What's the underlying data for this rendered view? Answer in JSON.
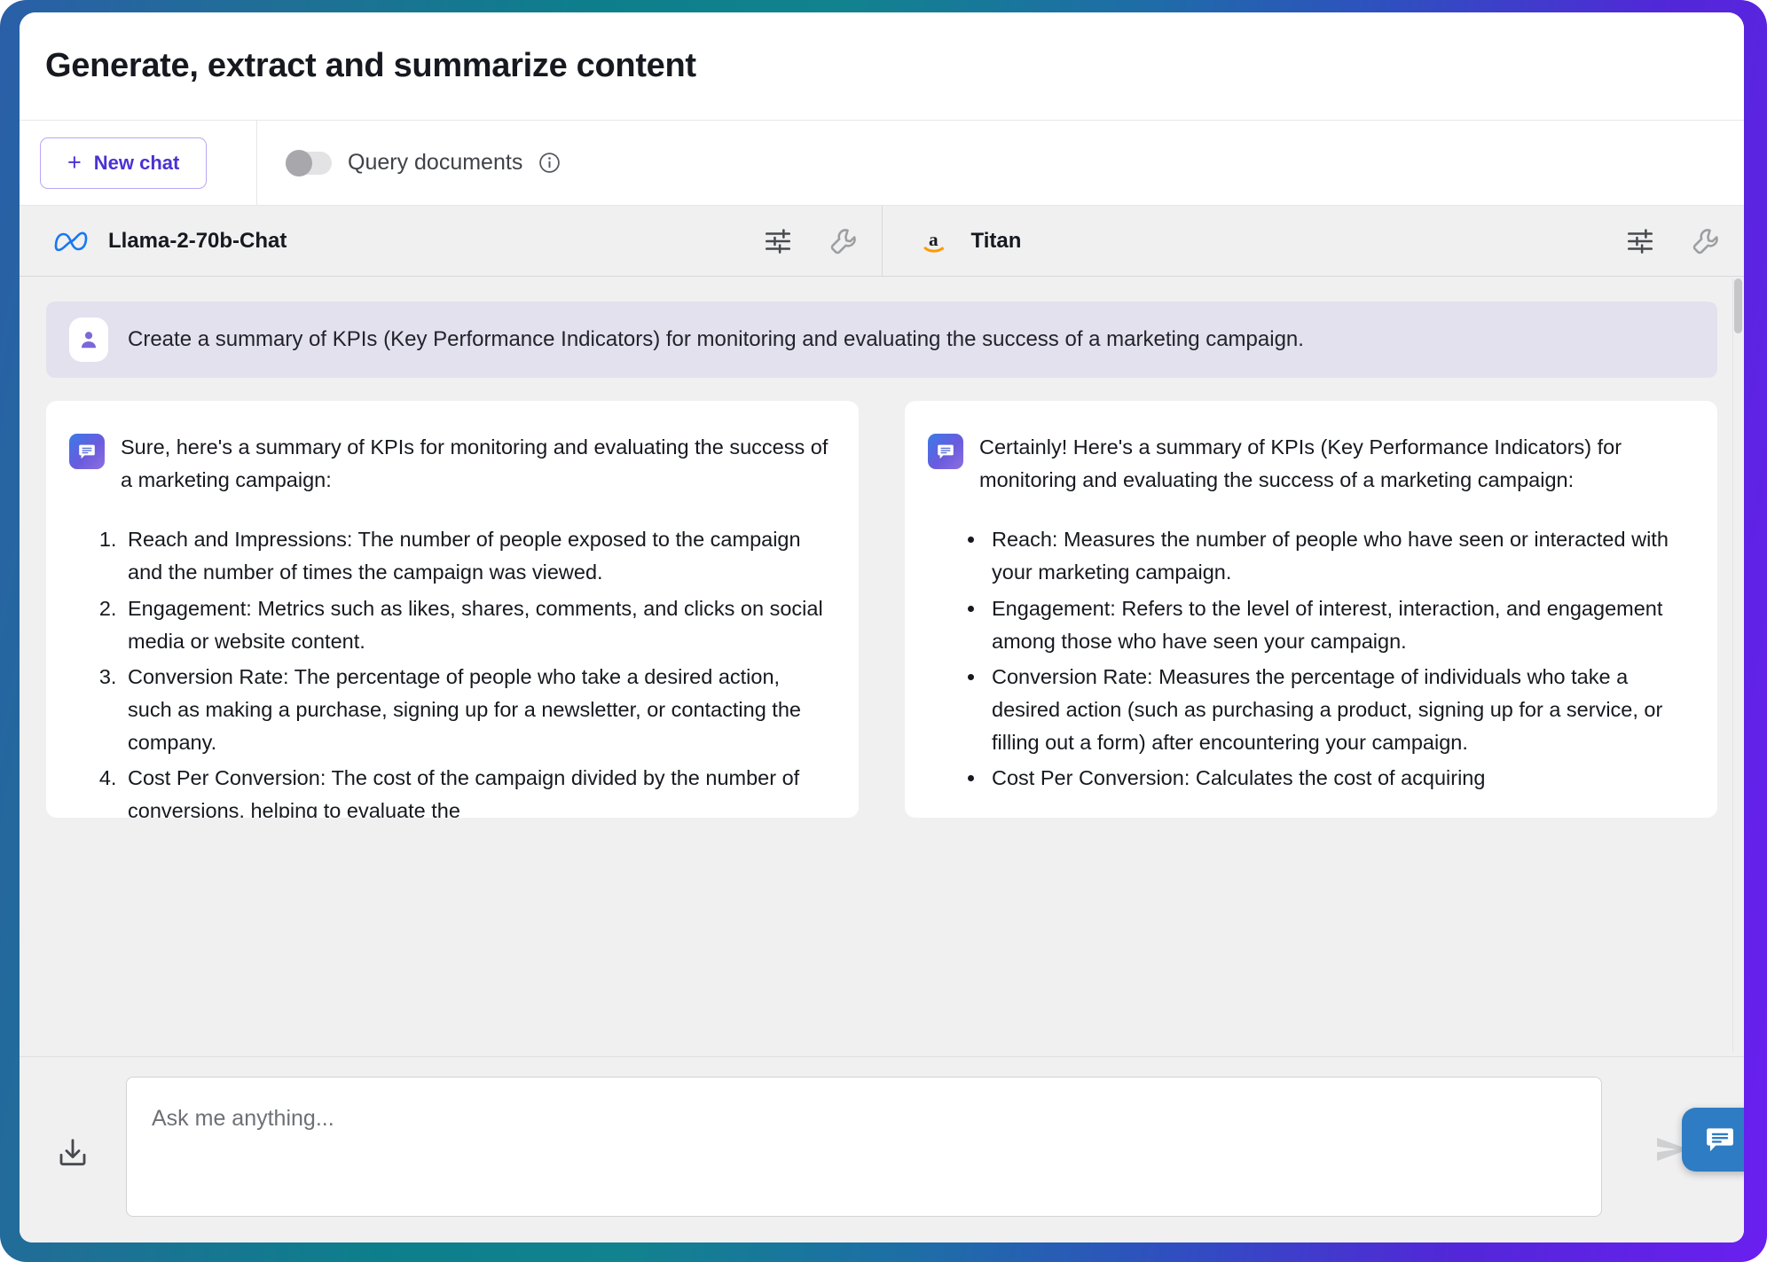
{
  "page": {
    "title": "Generate, extract and summarize content"
  },
  "toolbar": {
    "new_chat_label": "New chat",
    "plus_icon": "plus-icon",
    "query_documents_label": "Query documents",
    "query_documents_toggle_state": "off",
    "info_icon": "info-icon"
  },
  "models": [
    {
      "logo": "meta-infinity-logo",
      "name": "Llama-2-70b-Chat",
      "settings_icon": "sliders-icon",
      "tools_icon": "wrench-icon"
    },
    {
      "logo": "amazon-a-logo",
      "name": "Titan",
      "settings_icon": "sliders-icon",
      "tools_icon": "wrench-icon"
    }
  ],
  "prompt": {
    "avatar_icon": "user-avatar-icon",
    "text": "Create a summary of KPIs (Key Performance Indicators) for monitoring and evaluating the success of a marketing campaign."
  },
  "answers": [
    {
      "avatar_icon": "bot-message-icon",
      "intro": "Sure, here's a summary of KPIs for monitoring and evaluating the success of a marketing campaign:",
      "list_type": "ordered",
      "items": [
        "Reach and Impressions: The number of people exposed to the campaign and the number of times the campaign was viewed.",
        "Engagement: Metrics such as likes, shares, comments, and clicks on social media or website content.",
        "Conversion Rate: The percentage of people who take a desired action, such as making a purchase, signing up for a newsletter, or contacting the company.",
        "Cost Per Conversion: The cost of the campaign divided by the number of conversions, helping to evaluate the"
      ]
    },
    {
      "avatar_icon": "bot-message-icon",
      "intro": "Certainly! Here's a summary of KPIs (Key Performance Indicators) for monitoring and evaluating the success of a marketing campaign:",
      "list_type": "unordered",
      "items": [
        "Reach: Measures the number of people who have seen or interacted with your marketing campaign.",
        "Engagement: Refers to the level of interest, interaction, and engagement among those who have seen your campaign.",
        "Conversion Rate: Measures the percentage of individuals who take a desired action (such as purchasing a product, signing up for a service, or filling out a form) after encountering your campaign.",
        "Cost Per Conversion: Calculates the cost of acquiring"
      ]
    }
  ],
  "composer": {
    "placeholder": "Ask me anything...",
    "value": "",
    "download_icon": "download-icon",
    "send_icon": "send-icon"
  },
  "chat_widget": {
    "icon": "chat-bubble-icon"
  },
  "colors": {
    "accent_purple": "#4b32d4",
    "prompt_bar": "#e3e1ee",
    "surface": "#f0f0f1",
    "frame_gradient_start": "#2a5fa8",
    "frame_gradient_mid": "#0d7f8c",
    "frame_gradient_end": "#6a1ff0",
    "widget_blue": "#2e7cc4",
    "amazon_orange": "#ff9900",
    "meta_blue": "#1877f2"
  }
}
